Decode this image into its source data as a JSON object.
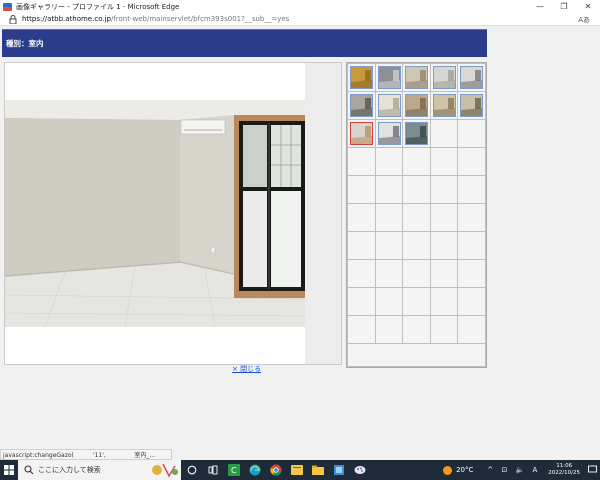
{
  "window": {
    "title": "画像ギャラリー - プロファイル 1 - Microsoft Edge",
    "buttons": [
      "—",
      "❐",
      "✕"
    ]
  },
  "address": {
    "domain": "https://atbb.athome.co.jp",
    "path": "/front-web/mainservlet/bfcm393s001?__sub__=yes",
    "readaloud_label": "Aあ"
  },
  "page": {
    "category_label": "種別：室内",
    "close_link": "× 閉じる"
  },
  "thumbnails": [
    {
      "name": "thumb-1",
      "theme": "door",
      "selected": false
    },
    {
      "name": "thumb-2",
      "theme": "kitchen",
      "selected": false
    },
    {
      "name": "thumb-3",
      "theme": "room",
      "selected": false
    },
    {
      "name": "thumb-4",
      "theme": "bath",
      "selected": false
    },
    {
      "name": "thumb-5",
      "theme": "sink",
      "selected": false
    },
    {
      "name": "thumb-6",
      "theme": "window",
      "selected": false
    },
    {
      "name": "thumb-7",
      "theme": "hall",
      "selected": false
    },
    {
      "name": "thumb-8",
      "theme": "closet",
      "selected": false
    },
    {
      "name": "thumb-9",
      "theme": "floor",
      "selected": false
    },
    {
      "name": "thumb-10",
      "theme": "corridor",
      "selected": false
    },
    {
      "name": "thumb-11",
      "theme": "room-window",
      "selected": true
    },
    {
      "name": "thumb-12",
      "theme": "washroom",
      "selected": false
    },
    {
      "name": "thumb-13",
      "theme": "balcony",
      "selected": false
    }
  ],
  "status": {
    "text": "javascript:changeGazo(          '11',               室内_..."
  },
  "taskbar": {
    "search_placeholder": "ここに入力して検索",
    "weather": "20°C",
    "sys_icons": "^ ⊡ 🔈 A",
    "time": "11:06",
    "date": "2022/10/25"
  }
}
